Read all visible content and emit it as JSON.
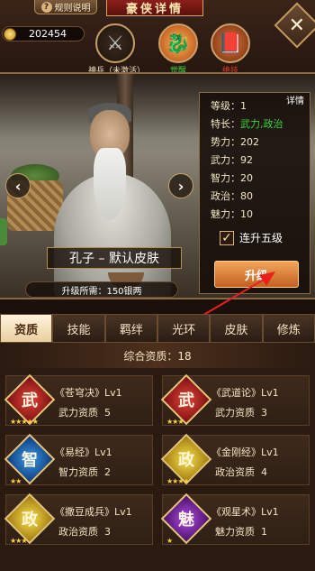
{
  "header": {
    "rules_label": "规则说明",
    "title": "豪侠详情",
    "close_glyph": "✕"
  },
  "currency": {
    "amount": "202454"
  },
  "skill_slots": [
    {
      "icon": "sword-icon",
      "label": "神兵（未激活）",
      "color": "#f3e3c3"
    },
    {
      "icon": "awaken-dragon-icon",
      "label": "觉醒",
      "color": "#3fd23f"
    },
    {
      "icon": "skill-book-icon",
      "label": "绝技",
      "color": "#e83a2a"
    }
  ],
  "hero": {
    "skin_name": "孔子 – 默认皮肤",
    "upgrade_cost": "升级所需：150银两"
  },
  "stats": {
    "detail_label": "详情",
    "level": {
      "label": "等级：",
      "value": "1"
    },
    "trait": {
      "label": "特长：",
      "value": "武力,政治"
    },
    "power": {
      "label": "势力：",
      "value": "202"
    },
    "force": {
      "label": "武力：",
      "value": "92"
    },
    "intellect": {
      "label": "智力：",
      "value": "20"
    },
    "politics": {
      "label": "政治：",
      "value": "80"
    },
    "charm": {
      "label": "魅力：",
      "value": "10"
    },
    "auto_upgrade_label": "连升五级",
    "auto_upgrade_checked": true,
    "upgrade_label": "升级"
  },
  "tabs": [
    {
      "label": "资质",
      "active": true
    },
    {
      "label": "技能",
      "active": false
    },
    {
      "label": "羁绊",
      "active": false
    },
    {
      "label": "光环",
      "active": false
    },
    {
      "label": "皮肤",
      "active": false
    },
    {
      "label": "修炼",
      "active": false
    }
  ],
  "aptitude": {
    "total_label": "综合资质：18",
    "cards": [
      {
        "name": "《苍穹决》Lv1",
        "attr": "武力资质",
        "value": "5",
        "glyph": "武",
        "color": "red",
        "stars": "★★★★★"
      },
      {
        "name": "《武道论》Lv1",
        "attr": "武力资质",
        "value": "3",
        "glyph": "武",
        "color": "red",
        "stars": "★★★"
      },
      {
        "name": "《易经》Lv1",
        "attr": "智力资质",
        "value": "2",
        "glyph": "智",
        "color": "blue",
        "stars": "★★"
      },
      {
        "name": "《金刚经》Lv1",
        "attr": "政治资质",
        "value": "4",
        "glyph": "政",
        "color": "gold",
        "stars": "★★★★"
      },
      {
        "name": "《撒豆成兵》Lv1",
        "attr": "政治资质",
        "value": "3",
        "glyph": "政",
        "color": "gold",
        "stars": "★★★"
      },
      {
        "name": "《观星术》Lv1",
        "attr": "魅力资质",
        "value": "1",
        "glyph": "魅",
        "color": "purple",
        "stars": "★"
      }
    ]
  }
}
